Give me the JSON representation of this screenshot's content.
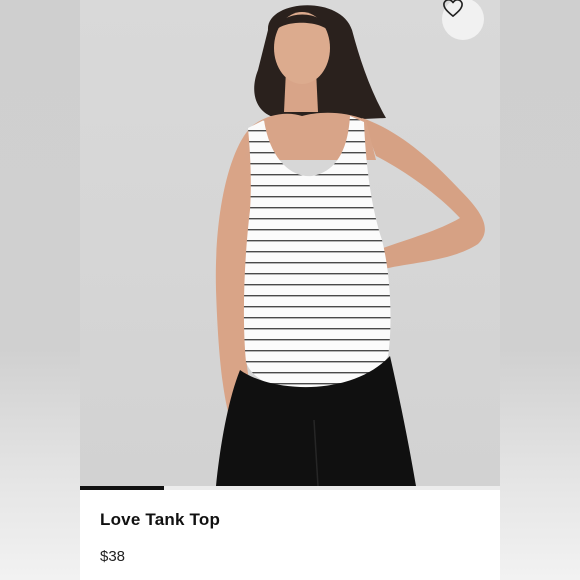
{
  "product": {
    "name": "Love Tank Top",
    "price": "$38"
  },
  "wishlist": {
    "icon": "heart-outline-icon"
  },
  "carousel": {
    "current_image": 1,
    "progress_fraction": 0.2
  },
  "colors": {
    "card_bg": "#ffffff",
    "photo_bg": "#d8d8d8",
    "text": "#111111",
    "progress": "#111111",
    "track": "#ececec"
  }
}
